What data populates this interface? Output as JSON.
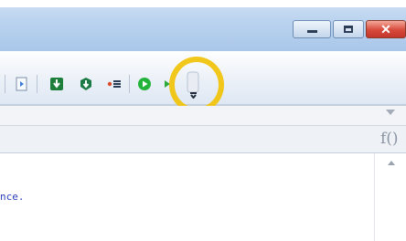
{
  "window": {
    "buttons": [
      "minimize",
      "maximize",
      "close"
    ],
    "close_glyph": "✕"
  },
  "toolbar": {
    "icons": [
      {
        "name": "document-arrow-icon",
        "color": "#3a7bd5"
      },
      {
        "name": "download-green-icon",
        "color": "#1a9a3a"
      },
      {
        "name": "shield-down-icon",
        "color": "#2a8a4a"
      },
      {
        "name": "breakpoint-list-icon",
        "color": "#d84a2a"
      },
      {
        "name": "play-circle-icon",
        "color": "#22b33a"
      },
      {
        "name": "step-icon",
        "color": "#2faa3a"
      },
      {
        "name": "overflow-menu-icon",
        "color": "#2b3d55"
      }
    ],
    "highlight_color": "#f1c40f"
  },
  "formula": {
    "fx_label": "f()"
  },
  "editor": {
    "code_fragment": "nce."
  }
}
